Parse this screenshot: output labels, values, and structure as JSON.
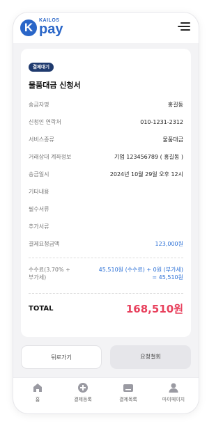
{
  "header": {
    "logo_small": "KAILOS",
    "logo_big": "pay",
    "logo_mark": "K",
    "menu_icon": "hamburger-menu-icon"
  },
  "card": {
    "badge": "결제대기",
    "title": "물품대금 신청서",
    "rows": [
      {
        "label": "송금자명",
        "value": "홍길동"
      },
      {
        "label": "신청인 연락처",
        "value": "010-1231-2312"
      },
      {
        "label": "서비스종류",
        "value": "물품대금"
      },
      {
        "label": "거래상대 계좌정보",
        "value": "기업 123456789 ( 홍길동 )"
      },
      {
        "label": "송금일시",
        "value": "2024년 10월 29일 오후 12시"
      },
      {
        "label": "기타내용",
        "value": ""
      },
      {
        "label": "필수서류",
        "value": ""
      },
      {
        "label": "추가서류",
        "value": ""
      },
      {
        "label": "결제요청금액",
        "value": "123,000원"
      }
    ],
    "fee": {
      "label_line1": "수수료(3.70% +",
      "label_line2": "부가세)",
      "value_line1": "45,510원 (수수료) + 0원 (부가세)",
      "value_line2": "= 45,510원"
    },
    "total": {
      "label": "TOTAL",
      "value": "168,510원"
    }
  },
  "buttons": {
    "back": "뒤로가기",
    "cancel_request": "요청철회"
  },
  "nav": {
    "items": [
      {
        "label": "홈",
        "icon": "home-icon"
      },
      {
        "label": "결제등록",
        "icon": "plus-circle-icon"
      },
      {
        "label": "결제목록",
        "icon": "card-list-icon"
      },
      {
        "label": "마이페이지",
        "icon": "person-icon"
      }
    ]
  },
  "colors": {
    "brand": "#2a66c8",
    "badge_bg": "#1f3a6e",
    "amount_blue": "#2a6fd6",
    "total_red": "#e8415d"
  }
}
